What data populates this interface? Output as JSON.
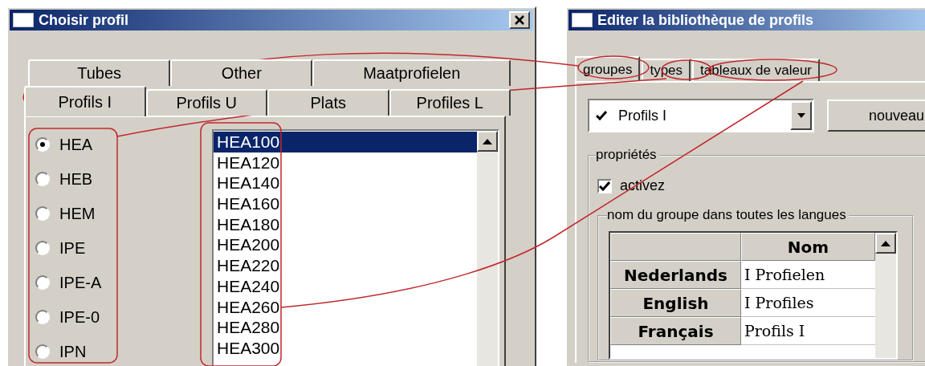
{
  "choose_dialog": {
    "title": "Choisir profil",
    "tab_rows": [
      [
        {
          "label": "Tubes",
          "selected": false
        },
        {
          "label": "Other",
          "selected": false
        },
        {
          "label": "Maatprofielen",
          "selected": false
        }
      ],
      [
        {
          "label": "Profils I",
          "selected": true
        },
        {
          "label": "Profils U",
          "selected": false
        },
        {
          "label": "Plats",
          "selected": false
        },
        {
          "label": "Profiles L",
          "selected": false
        }
      ]
    ],
    "radios": [
      {
        "label": "HEA",
        "selected": true
      },
      {
        "label": "HEB",
        "selected": false
      },
      {
        "label": "HEM",
        "selected": false
      },
      {
        "label": "IPE",
        "selected": false
      },
      {
        "label": "IPE-A",
        "selected": false
      },
      {
        "label": "IPE-0",
        "selected": false
      },
      {
        "label": "IPN",
        "selected": false
      }
    ],
    "list_items": [
      {
        "label": "HEA100",
        "selected": true
      },
      {
        "label": "HEA120",
        "selected": false
      },
      {
        "label": "HEA140",
        "selected": false
      },
      {
        "label": "HEA160",
        "selected": false
      },
      {
        "label": "HEA180",
        "selected": false
      },
      {
        "label": "HEA200",
        "selected": false
      },
      {
        "label": "HEA220",
        "selected": false
      },
      {
        "label": "HEA240",
        "selected": false
      },
      {
        "label": "HEA260",
        "selected": false
      },
      {
        "label": "HEA280",
        "selected": false
      },
      {
        "label": "HEA300",
        "selected": false
      }
    ]
  },
  "library_dialog": {
    "title": "Editer la bibliothèque de profils",
    "tabs": [
      {
        "label": "groupes",
        "selected": true
      },
      {
        "label": "types",
        "selected": false
      },
      {
        "label": "tableaux de valeur",
        "selected": false
      }
    ],
    "group_select": {
      "value": "Profils I"
    },
    "new_button": "nouveau",
    "properties": {
      "legend": "propriétés",
      "active": {
        "label": "activez",
        "checked": true
      },
      "names": {
        "legend": "nom du groupe dans toutes les langues",
        "column": "Nom",
        "rows": [
          {
            "language": "Nederlands",
            "name": "I Profielen"
          },
          {
            "language": "English",
            "name": "I Profiles"
          },
          {
            "language": "Français",
            "name": "Profils I"
          }
        ]
      }
    }
  }
}
